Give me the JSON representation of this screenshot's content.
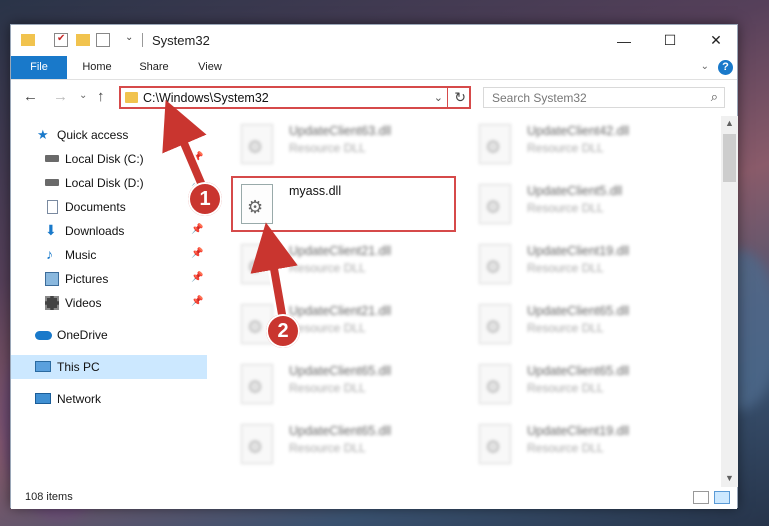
{
  "window": {
    "title": "System32",
    "controls": {
      "minimize": "—",
      "maximize": "☐",
      "close": "✕"
    }
  },
  "ribbon": {
    "tabs": [
      "File",
      "Home",
      "Share",
      "View"
    ],
    "help": "?",
    "expand": "⌄"
  },
  "nav": {
    "back": "←",
    "forward": "→",
    "recent": "⌄",
    "up": "↑",
    "address": "C:\\Windows\\System32",
    "address_dropdown": "⌄",
    "refresh": "↻",
    "search_placeholder": "Search System32"
  },
  "sidebar": {
    "items": [
      {
        "label": "Quick access",
        "icon": "star-icon",
        "pinned": false
      },
      {
        "label": "Local Disk (C:)",
        "icon": "drive-icon",
        "pinned": true
      },
      {
        "label": "Local Disk (D:)",
        "icon": "drive-icon",
        "pinned": true
      },
      {
        "label": "Documents",
        "icon": "documents-icon",
        "pinned": true
      },
      {
        "label": "Downloads",
        "icon": "downloads-icon",
        "pinned": true
      },
      {
        "label": "Music",
        "icon": "music-icon",
        "pinned": true
      },
      {
        "label": "Pictures",
        "icon": "pictures-icon",
        "pinned": true
      },
      {
        "label": "Videos",
        "icon": "videos-icon",
        "pinned": true
      },
      {
        "label": "OneDrive",
        "icon": "cloud-icon",
        "pinned": false
      },
      {
        "label": "This PC",
        "icon": "computer-icon",
        "pinned": false,
        "selected": true
      },
      {
        "label": "Network",
        "icon": "network-icon",
        "pinned": false
      }
    ]
  },
  "files": {
    "left": [
      {
        "name": "UpdateClient63.dll",
        "type": "Resource DLL"
      },
      {
        "name": "myass.dll",
        "type": "",
        "highlighted": true
      },
      {
        "name": "UpdateClient21.dll",
        "type": "Resource DLL"
      },
      {
        "name": "UpdateClient21.dll",
        "type": "Resource DLL"
      },
      {
        "name": "UpdateClient65.dll",
        "type": "Resource DLL"
      },
      {
        "name": "UpdateClient65.dll",
        "type": "Resource DLL"
      }
    ],
    "right": [
      {
        "name": "UpdateClient42.dll",
        "type": "Resource DLL"
      },
      {
        "name": "UpdateClient5.dll",
        "type": "Resource DLL"
      },
      {
        "name": "UpdateClient19.dll",
        "type": "Resource DLL"
      },
      {
        "name": "UpdateClient65.dll",
        "type": "Resource DLL"
      },
      {
        "name": "UpdateClient65.dll",
        "type": "Resource DLL"
      },
      {
        "name": "UpdateClient19.dll",
        "type": "Resource DLL"
      }
    ]
  },
  "status": {
    "item_count": "108 items"
  },
  "annotations": {
    "step1": "1",
    "step2": "2",
    "color": "#c9352f"
  },
  "colors": {
    "accent": "#1979ca",
    "highlight_border": "#d64a4a",
    "selected_bg": "#cce8ff"
  }
}
